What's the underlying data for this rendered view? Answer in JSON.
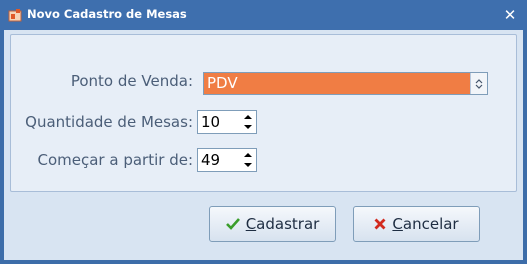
{
  "window": {
    "title": "Novo Cadastro de Mesas",
    "close_glyph": "✕"
  },
  "form": {
    "ponto_label": "Ponto de Venda:",
    "ponto_value": "PDV",
    "quantidade_label": "Quantidade de Mesas:",
    "quantidade_value": "10",
    "comecar_label": "Começar a partir de:",
    "comecar_value": "49"
  },
  "buttons": {
    "cadastrar_mnemonic": "C",
    "cadastrar_rest": "adastrar",
    "cancelar_mnemonic": "C",
    "cancelar_rest": "ancelar"
  },
  "colors": {
    "title_bar": "#3e6fae",
    "combo_selected": "#f07d44",
    "check_icon": "#3a9d2b",
    "cancel_icon": "#d22a1e"
  },
  "icons": {
    "app": "app-icon",
    "close": "close-icon",
    "combo": "updown-chevron-icon",
    "check": "check-icon",
    "cancel": "x-mark-icon"
  }
}
